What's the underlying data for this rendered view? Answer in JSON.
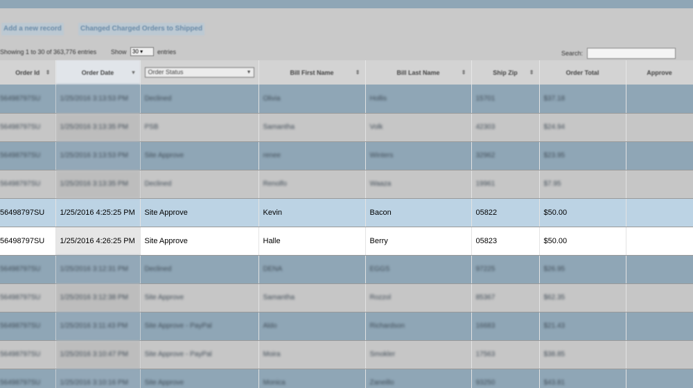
{
  "actions": {
    "add_record": "Add a new record",
    "change_charged": "Changed Charged Orders to Shipped"
  },
  "controls": {
    "info": "Showing 1 to 30 of 363,776 entries",
    "show_label": "Show",
    "show_value": "30",
    "entries_label": "entries",
    "search_label": "Search:"
  },
  "columns": {
    "order_id": "Order Id",
    "order_date": "Order Date",
    "order_status": "Order Status",
    "bill_first": "Bill First Name",
    "bill_last": "Bill Last Name",
    "ship_zip": "Ship Zip",
    "order_total": "Order Total",
    "approve": "Approve"
  },
  "rows": [
    {
      "id": "56498797SU",
      "date": "1/25/2016 3:13:53 PM",
      "status": "Declined",
      "first": "Olivia",
      "last": "Hollis",
      "zip": "15701",
      "total": "$37.18",
      "approve": ""
    },
    {
      "id": "56498797SU",
      "date": "1/25/2016 3:13:35 PM",
      "status": "PSB",
      "first": "Samantha",
      "last": "Volk",
      "zip": "42303",
      "total": "$24.94",
      "approve": ""
    },
    {
      "id": "56498797SU",
      "date": "1/25/2016 3:13:53 PM",
      "status": "Site Approve",
      "first": "renee",
      "last": "Winters",
      "zip": "32962",
      "total": "$23.95",
      "approve": ""
    },
    {
      "id": "56498797SU",
      "date": "1/25/2016 3:13:35 PM",
      "status": "Declined",
      "first": "Renolfo",
      "last": "Waaza",
      "zip": "19961",
      "total": "$7.95",
      "approve": ""
    },
    {
      "id": "56498797SU",
      "date": "1/25/2016 4:25:25 PM",
      "status": "Site Approve",
      "first": "Kevin",
      "last": "Bacon",
      "zip": "05822",
      "total": "$50.00",
      "approve": ""
    },
    {
      "id": "56498797SU",
      "date": "1/25/2016 4:26:25 PM",
      "status": "Site Approve",
      "first": "Halle",
      "last": "Berry",
      "zip": "05823",
      "total": "$50.00",
      "approve": ""
    },
    {
      "id": "56498797SU",
      "date": "1/25/2016 3:12:31 PM",
      "status": "Declined",
      "first": "DENA",
      "last": "EGGS",
      "zip": "97225",
      "total": "$26.95",
      "approve": ""
    },
    {
      "id": "56498797SU",
      "date": "1/25/2016 3:12:38 PM",
      "status": "Site Approve",
      "first": "Samantha",
      "last": "Rozzol",
      "zip": "85367",
      "total": "$62.35",
      "approve": ""
    },
    {
      "id": "56498797SU",
      "date": "1/25/2016 3:11:43 PM",
      "status": "Site Approve - PayPal",
      "first": "Aldo",
      "last": "Richardson",
      "zip": "16683",
      "total": "$21.43",
      "approve": ""
    },
    {
      "id": "56498797SU",
      "date": "1/25/2016 3:10:47 PM",
      "status": "Site Approve - PayPal",
      "first": "Moira",
      "last": "Smokler",
      "zip": "17563",
      "total": "$38.85",
      "approve": ""
    },
    {
      "id": "56498797SU",
      "date": "1/25/2016 3:10:16 PM",
      "status": "Site Approve",
      "first": "Monica",
      "last": "Zaneillo",
      "zip": "93250",
      "total": "$43.81",
      "approve": ""
    }
  ]
}
